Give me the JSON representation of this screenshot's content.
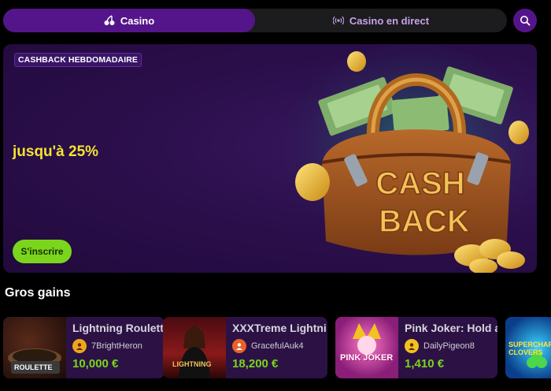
{
  "tabs": [
    {
      "label": "Casino",
      "icon": "cherries-icon",
      "active": true
    },
    {
      "label": "Casino en direct",
      "icon": "live-broadcast-icon",
      "active": false
    }
  ],
  "search": {
    "icon": "search-icon"
  },
  "hero": {
    "badge": "CASHBACK HEBDOMADAIRE",
    "headline": "jusqu'à 25%",
    "cta": "S'inscrire",
    "art_text_line1": "CASH",
    "art_text_line2": "BACK"
  },
  "big_wins": {
    "title": "Gros gains",
    "items": [
      {
        "game": "Lightning Roulette",
        "user": "7BrightHeron",
        "amount": "10,000 €",
        "thumb_text": "ROULETTE"
      },
      {
        "game": "XXXTreme Lightning Roulette",
        "user": "GracefulAuk4",
        "amount": "18,200 €",
        "thumb_text": "LIGHTNING"
      },
      {
        "game": "Pink Joker: Hold and Win",
        "user": "DailyPigeon8",
        "amount": "1,410 €",
        "thumb_text": "PINK JOKER"
      },
      {
        "game": "",
        "user": "",
        "amount": "",
        "thumb_text": "SUPERCHARGED CLOVERS"
      }
    ]
  },
  "colors": {
    "accent_purple": "#55158a",
    "cta_green": "#7bd51d",
    "headline_yellow": "#f3e331",
    "card_bg": "#2c1244"
  }
}
